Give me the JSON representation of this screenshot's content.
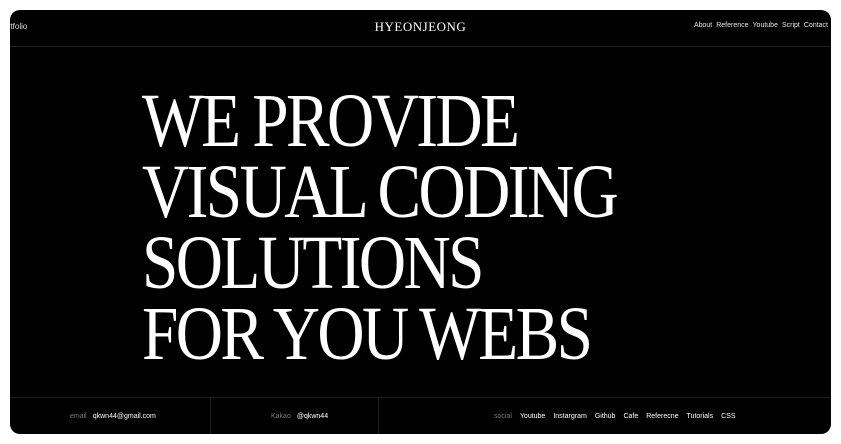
{
  "header": {
    "brand": "Portfolio",
    "site_title": "HYEONJEONG",
    "nav": [
      "About",
      "Reference",
      "Youtube",
      "Script",
      "Contact"
    ]
  },
  "hero": {
    "lines": [
      "WE PROVIDE",
      "VISUAL CODING",
      "SOLUTIONS",
      "FOR YOU WEBS"
    ]
  },
  "footer": {
    "email_label": "email",
    "email_value": "qkwn44@gmail.com",
    "kakao_label": "Kakao",
    "kakao_value": "@qkwn44",
    "social_label": "social",
    "social_links": [
      "Youtube",
      "Instargram",
      "Github",
      "Cafe",
      "Referecne",
      "Tutorials",
      "CSS"
    ]
  },
  "colors": {
    "background": "#000000",
    "text": "#ffffff",
    "muted": "#7a7a7a",
    "divider": "#1e1e1e"
  }
}
